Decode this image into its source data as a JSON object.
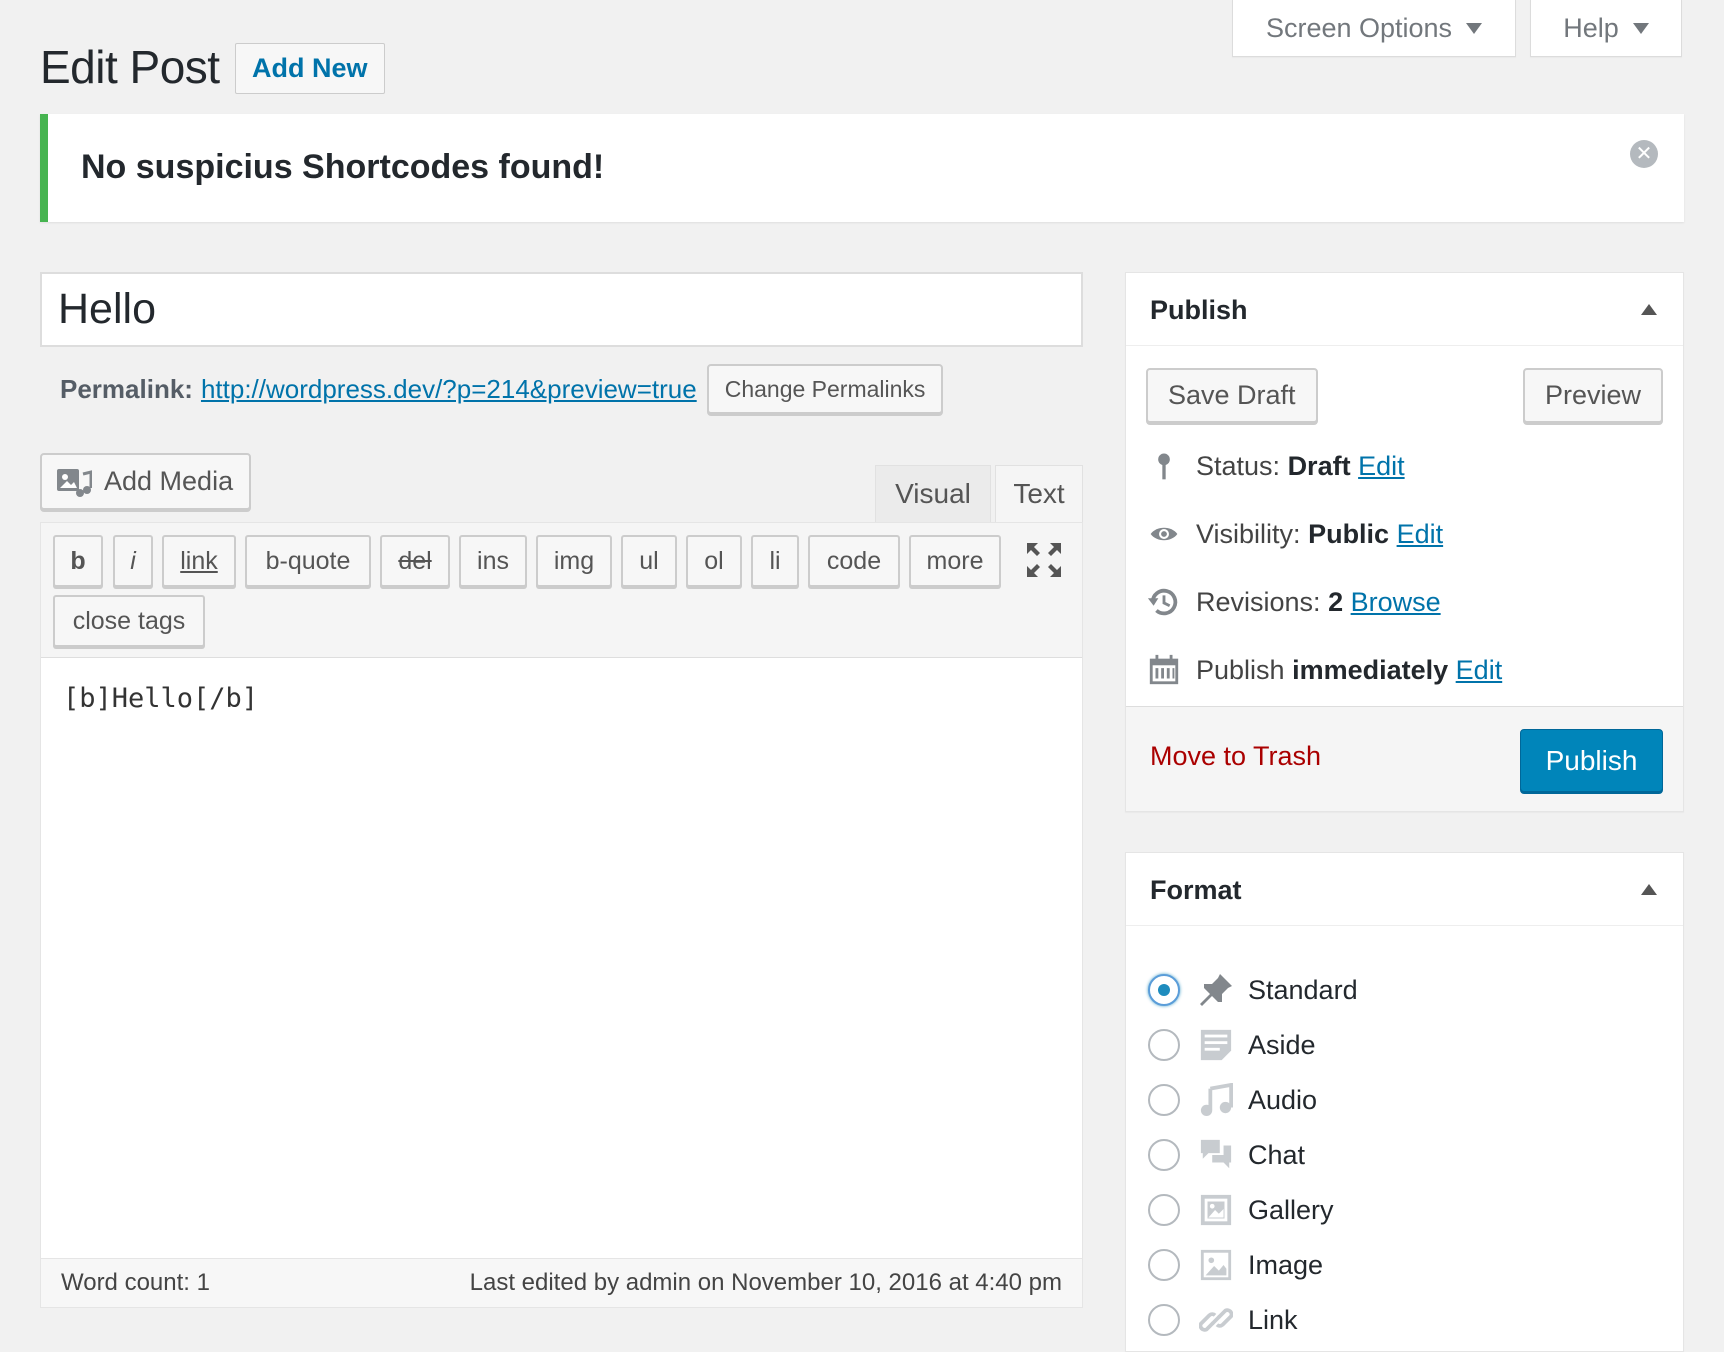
{
  "screen_meta": {
    "screen_options_label": "Screen Options",
    "help_label": "Help"
  },
  "header": {
    "title": "Edit Post",
    "add_new_label": "Add New"
  },
  "notice": {
    "text": "No suspicius Shortcodes found!"
  },
  "post": {
    "title": "Hello",
    "permalink_label": "Permalink:",
    "permalink_url": "http://wordpress.dev/?p=214&preview=true",
    "change_permalinks_label": "Change Permalinks"
  },
  "editor": {
    "add_media_label": "Add Media",
    "tabs": {
      "visual": "Visual",
      "text": "Text"
    },
    "quicktags": [
      "b",
      "i",
      "link",
      "b-quote",
      "del",
      "ins",
      "img",
      "ul",
      "ol",
      "li",
      "code",
      "more",
      "close tags"
    ],
    "content": "[b]Hello[/b]",
    "word_count": "Word count: 1",
    "last_edited": "Last edited by admin on November 10, 2016 at 4:40 pm"
  },
  "publish_box": {
    "title": "Publish",
    "save_draft_label": "Save Draft",
    "preview_label": "Preview",
    "status_label": "Status:",
    "status_value": "Draft",
    "visibility_label": "Visibility:",
    "visibility_value": "Public",
    "revisions_label": "Revisions:",
    "revisions_value": "2",
    "browse_label": "Browse",
    "publish_label": "Publish",
    "publish_value": "immediately",
    "edit_label": "Edit",
    "trash_label": "Move to Trash",
    "publish_button_label": "Publish"
  },
  "format_box": {
    "title": "Format",
    "options": [
      {
        "label": "Standard",
        "icon": "pin-icon",
        "selected": true
      },
      {
        "label": "Aside",
        "icon": "aside-icon",
        "selected": false
      },
      {
        "label": "Audio",
        "icon": "audio-icon",
        "selected": false
      },
      {
        "label": "Chat",
        "icon": "chat-icon",
        "selected": false
      },
      {
        "label": "Gallery",
        "icon": "gallery-icon",
        "selected": false
      },
      {
        "label": "Image",
        "icon": "image-icon",
        "selected": false
      },
      {
        "label": "Link",
        "icon": "link-icon",
        "selected": false
      }
    ]
  },
  "colors": {
    "accent": "#0073aa",
    "primary_button": "#0085ba",
    "notice_success": "#46b450",
    "trash": "#aa0000"
  }
}
